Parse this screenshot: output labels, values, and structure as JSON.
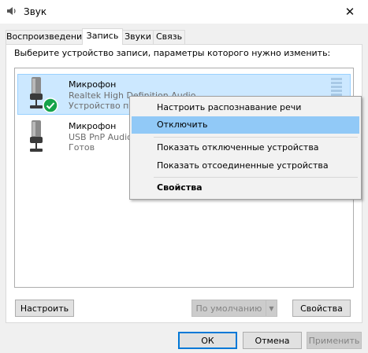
{
  "window": {
    "title": "Звук",
    "close_glyph": "✕",
    "icon": "speaker-icon"
  },
  "tabs": [
    {
      "label": "Воспроизведение",
      "active": false
    },
    {
      "label": "Запись",
      "active": true
    },
    {
      "label": "Звуки",
      "active": false
    },
    {
      "label": "Связь",
      "active": false
    }
  ],
  "prompt": "Выберите устройство записи, параметры которого нужно изменить:",
  "devices": [
    {
      "name": "Микрофон",
      "driver": "Realtek High Definition Audio",
      "status": "Устройство по",
      "selected": true,
      "default_badge": true,
      "icon": "microphone-icon"
    },
    {
      "name": "Микрофон",
      "driver": "USB PnP Audio",
      "status": "Готов",
      "selected": false,
      "default_badge": false,
      "icon": "microphone-icon"
    }
  ],
  "context_menu": {
    "items": [
      {
        "label": "Настроить распознавание речи"
      },
      {
        "label": "Отключить",
        "highlighted": true
      },
      {
        "label": "Показать отключенные устройства"
      },
      {
        "label": "Показать отсоединенные устройства"
      },
      {
        "label": "Свойства",
        "bold": true
      }
    ]
  },
  "buttons": {
    "configure": "Настроить",
    "set_default": "По умолчанию",
    "properties": "Свойства",
    "ok": "ОК",
    "cancel": "Отмена",
    "apply": "Применить"
  },
  "colors": {
    "selection": "#cce8ff",
    "menu_highlight": "#91c9f7",
    "accent": "#0078d7",
    "check_badge": "#16a34a"
  }
}
